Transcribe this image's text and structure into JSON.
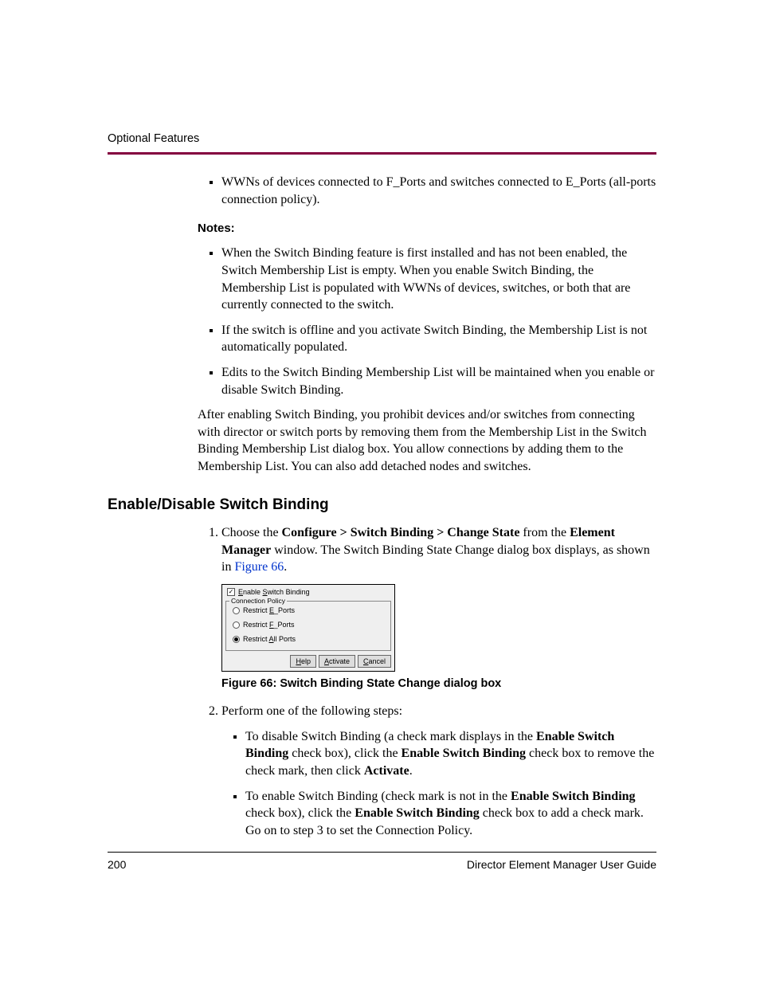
{
  "header": {
    "running": "Optional Features"
  },
  "body": {
    "intro_bullet": "WWNs of devices connected to F_Ports and switches connected to E_Ports (all-ports connection policy).",
    "notes_label": "Notes:",
    "notes": [
      "When the Switch Binding feature is first installed and has not been enabled, the Switch Membership List is empty. When you enable Switch Binding, the Membership List is populated with WWNs of devices, switches, or both that are currently connected to the switch.",
      "If the switch is offline and you activate Switch Binding, the Membership List is not automatically populated.",
      "Edits to the Switch Binding Membership List will be maintained when you enable or disable Switch Binding."
    ],
    "after_para": "After enabling Switch Binding, you prohibit devices and/or switches from connecting with director or switch ports by removing them from the Membership List in the Switch Binding Membership List dialog box. You allow connections by adding them to the Membership List. You can also add detached nodes and switches."
  },
  "section": {
    "heading": "Enable/Disable Switch Binding",
    "step1": {
      "pre": "Choose the ",
      "b1": "Configure > Switch Binding > Change State",
      "mid": " from the ",
      "b2": "Element Manager",
      "post": " window. The Switch Binding State Change dialog box displays, as shown in ",
      "xref": "Figure 66",
      "end": "."
    },
    "figcap": "Figure 66:  Switch Binding State Change dialog box",
    "step2_intro": "Perform one of the following steps:",
    "step2_items": [
      {
        "pre": "To disable Switch Binding (a check mark displays in the ",
        "b1": "Enable Switch Binding",
        "mid1": " check box), click the ",
        "b2": "Enable Switch Binding",
        "mid2": " check box to remove the check mark, then click ",
        "b3": "Activate",
        "post": "."
      },
      {
        "pre": "To enable Switch Binding (check mark is not in the ",
        "b1": "Enable Switch Binding",
        "mid1": " check box), click the ",
        "b2": "Enable Switch Binding",
        "mid2": " check box to add a check mark. Go on to step 3 to set the Connection Policy.",
        "b3": "",
        "post": ""
      }
    ]
  },
  "dialog": {
    "enable_prefix": "nable ",
    "enable_mid": "witch Binding",
    "legend": "Connection Policy",
    "opt1_pre": "Restrict ",
    "opt1_ul": "E",
    "opt1_post": "_Ports",
    "opt2_pre": "Restrict ",
    "opt2_ul": "F",
    "opt2_post": "_Ports",
    "opt3_pre": "Restrict ",
    "opt3_ul": "A",
    "opt3_post": "ll Ports",
    "btn_help": "elp",
    "btn_activate": "ctivate",
    "btn_cancel": "ancel"
  },
  "footer": {
    "page": "200",
    "title": "Director Element Manager User Guide"
  }
}
